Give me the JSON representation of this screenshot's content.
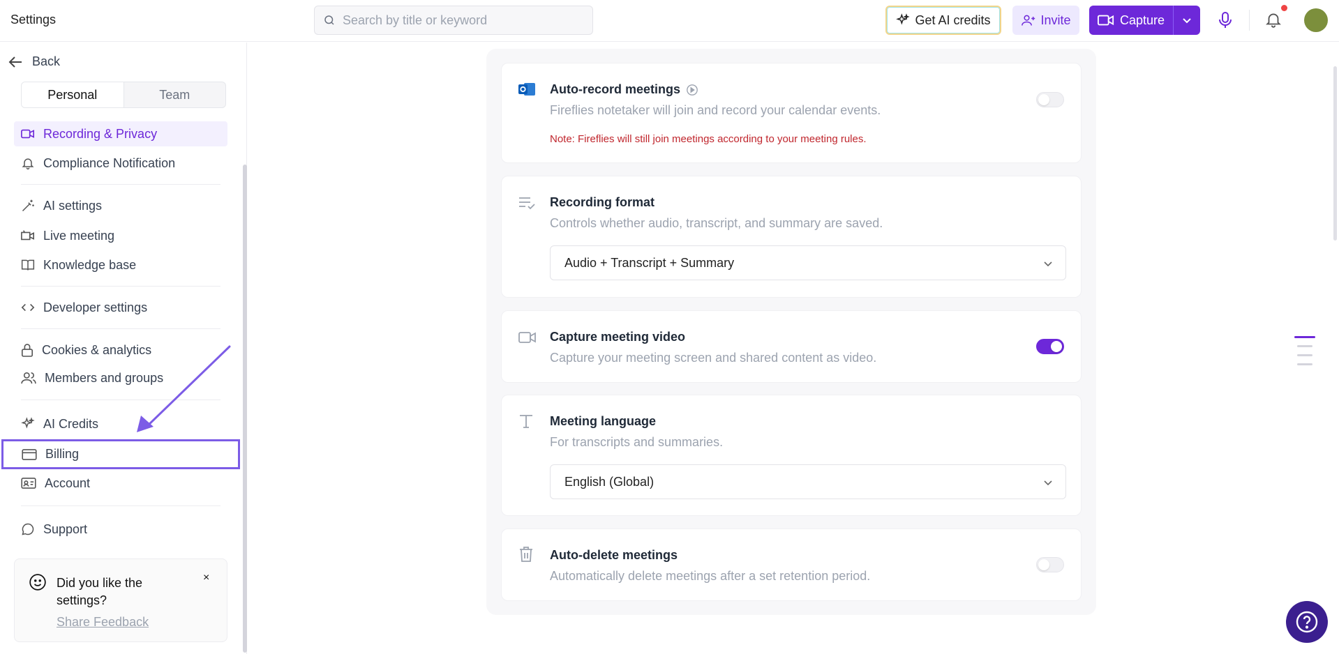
{
  "header": {
    "title": "Settings",
    "search_placeholder": "Search by title or keyword",
    "get_credits_label": "Get AI credits",
    "invite_label": "Invite",
    "capture_label": "Capture"
  },
  "sidebar": {
    "back_label": "Back",
    "tabs": [
      "Personal",
      "Team"
    ],
    "items": [
      {
        "label": "Recording & Privacy",
        "icon": "video-icon"
      },
      {
        "label": "Compliance Notification",
        "icon": "bell-icon"
      },
      {
        "label": "AI settings",
        "icon": "magic-wand-icon"
      },
      {
        "label": "Live meeting",
        "icon": "live-video-icon"
      },
      {
        "label": "Knowledge base",
        "icon": "book-icon"
      },
      {
        "label": "Developer settings",
        "icon": "code-icon"
      },
      {
        "label": "Cookies & analytics",
        "icon": "lock-icon"
      },
      {
        "label": "Members and groups",
        "icon": "users-icon"
      },
      {
        "label": "AI Credits",
        "icon": "sparkle-icon"
      },
      {
        "label": "Billing",
        "icon": "credit-card-icon"
      },
      {
        "label": "Account",
        "icon": "id-card-icon"
      },
      {
        "label": "Support",
        "icon": "chat-icon"
      }
    ],
    "feedback": {
      "question": "Did you like the settings?",
      "link": "Share Feedback",
      "close": "×"
    }
  },
  "main": {
    "auto_record": {
      "title": "Auto-record meetings",
      "desc": "Fireflies notetaker will join and record your calendar events.",
      "note": "Note: Fireflies will still join meetings according to your meeting rules.",
      "enabled": false
    },
    "recording_format": {
      "title": "Recording format",
      "desc": "Controls whether audio, transcript, and summary are saved.",
      "value": "Audio + Transcript + Summary"
    },
    "capture_video": {
      "title": "Capture meeting video",
      "desc": "Capture your meeting screen and shared content as video.",
      "enabled": true
    },
    "meeting_language": {
      "title": "Meeting language",
      "desc": "For transcripts and summaries.",
      "value": "English (Global)"
    },
    "auto_delete": {
      "title": "Auto-delete meetings",
      "desc": "Automatically delete meetings after a set retention period.",
      "enabled": false
    }
  },
  "colors": {
    "accent": "#6d28d9",
    "accent_light": "#f3f0fe",
    "note_red": "#c0262d",
    "highlight_box": "#7c5ce6"
  }
}
